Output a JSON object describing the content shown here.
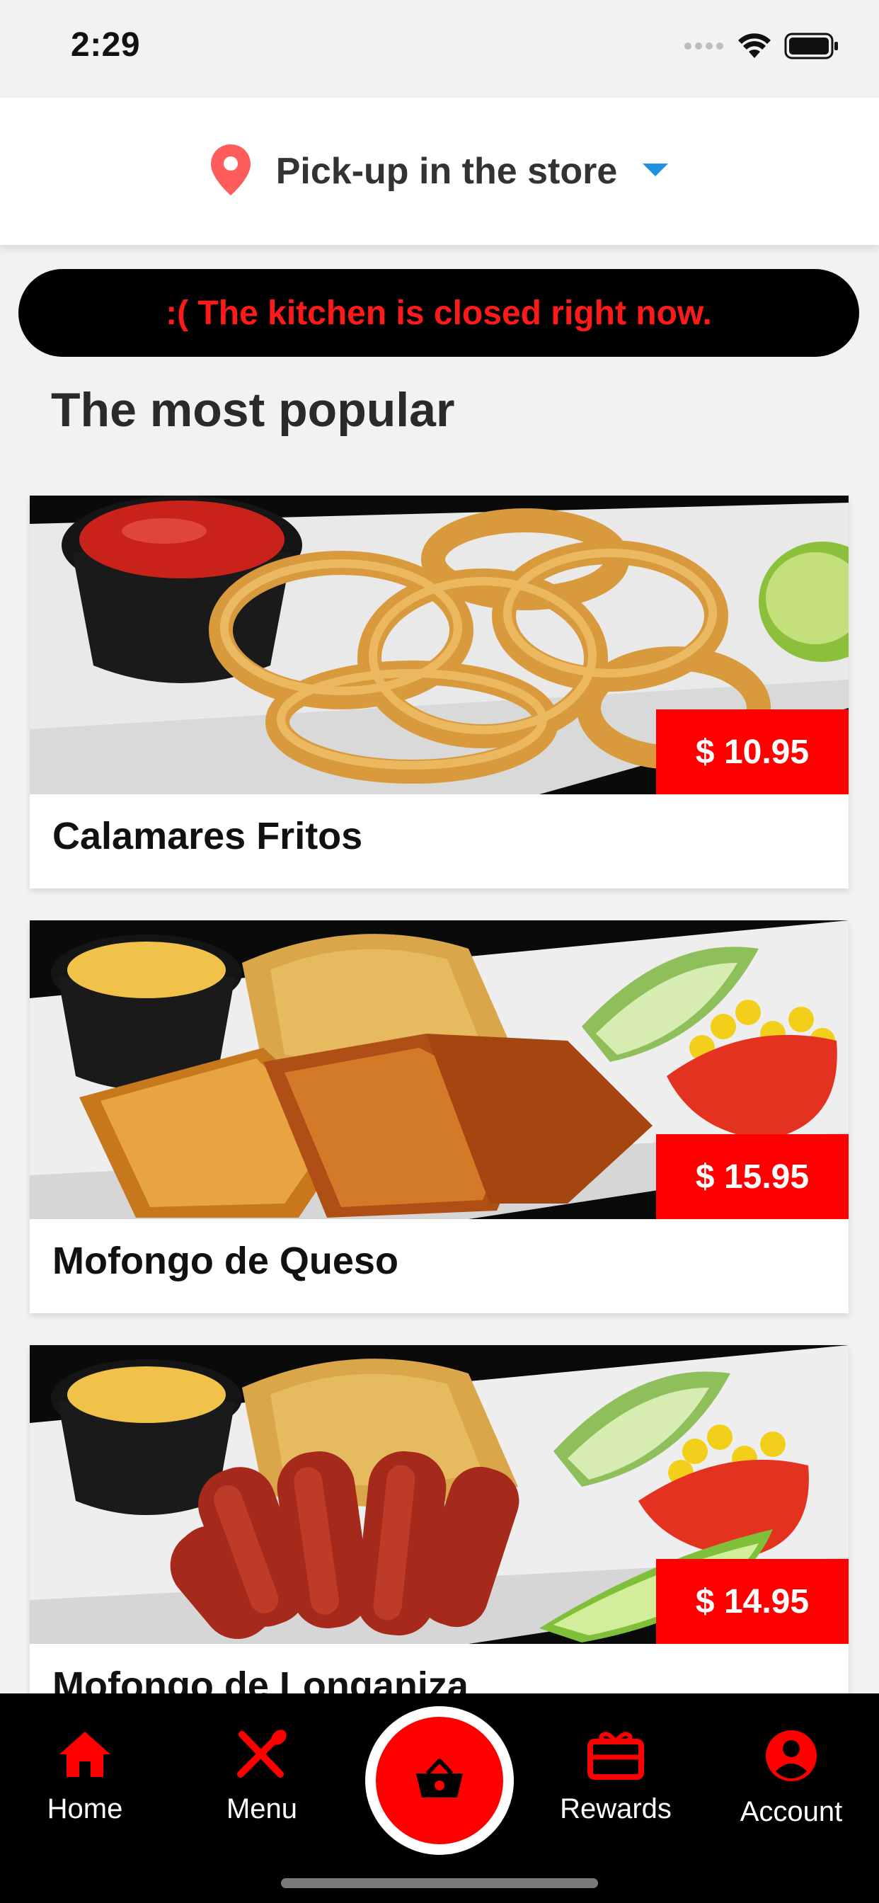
{
  "status_bar": {
    "time": "2:29"
  },
  "header": {
    "delivery_mode": "Pick-up in the store",
    "location_icon": "location-pin-icon",
    "dropdown_icon": "triangle-down-icon",
    "pin_color": "#ff5c5c",
    "caret_color": "#1e90e0"
  },
  "banner": {
    "message": ":( The kitchen is closed right now."
  },
  "section": {
    "title": "The most popular"
  },
  "products": [
    {
      "name": "Calamares Fritos",
      "price": "$ 10.95"
    },
    {
      "name": "Mofongo de Queso",
      "price": "$ 15.95"
    },
    {
      "name": "Mofongo de Longaniza",
      "price": "$ 14.95"
    }
  ],
  "nav": {
    "home": "Home",
    "menu": "Menu",
    "rewards": "Rewards",
    "account": "Account"
  },
  "colors": {
    "accent": "#ff0000",
    "banner_bg": "#000000",
    "banner_text": "#ff1a1a",
    "nav_bg": "#000000"
  }
}
